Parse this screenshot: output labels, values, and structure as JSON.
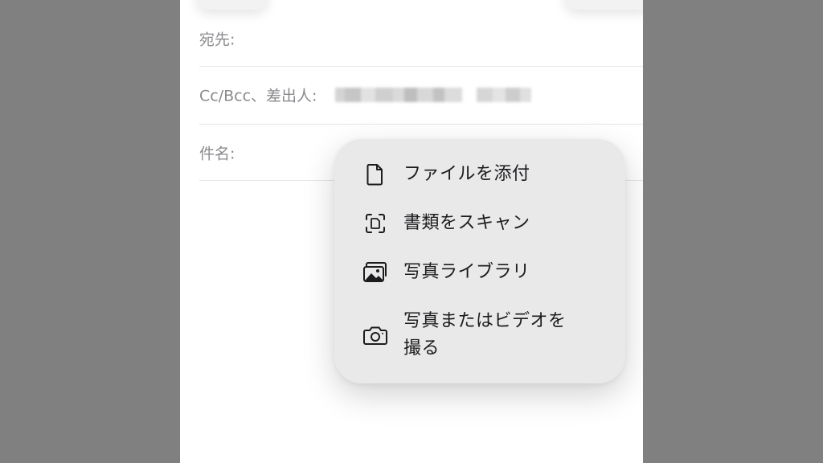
{
  "compose": {
    "to_label": "宛先:",
    "cc_label": "Cc/Bcc、差出人:",
    "subject_label": "件名:"
  },
  "attach_menu": {
    "items": [
      {
        "label": "ファイルを添付",
        "icon": "document-icon"
      },
      {
        "label": "書類をスキャン",
        "icon": "scan-document-icon"
      },
      {
        "label": "写真ライブラリ",
        "icon": "photo-library-icon"
      },
      {
        "label_line1": "写真またはビデオを",
        "label_line2": "撮る",
        "icon": "camera-icon"
      }
    ]
  },
  "colors": {
    "background": "#808080",
    "sheet": "#ffffff",
    "menu": "#e9e9ea",
    "label": "#8a8a8e",
    "text": "#1c1c1e"
  }
}
